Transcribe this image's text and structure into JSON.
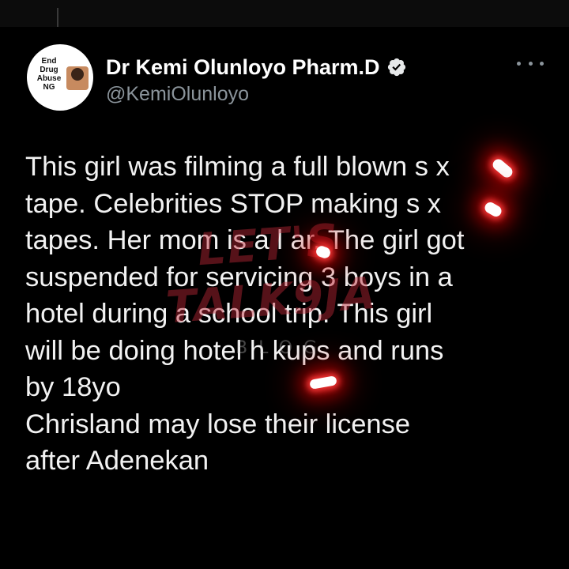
{
  "tweet": {
    "avatar_logo_text": "End Drug Abuse NG",
    "display_name": "Dr Kemi Olunloyo Pharm.D",
    "handle": "@KemiOlunloyo",
    "body_lines": [
      "This girl was filming a full blown s  x",
      "tape. Celebrities STOP making s  x",
      "tapes. Her mom is a l  ar. The girl got",
      "suspended for servicing 3 boys in a",
      "hotel during a school trip. This girl",
      "will be doing hotel h     kups and runs",
      "by 18yo",
      "Chrisland may lose their license",
      "after Adenekan"
    ]
  },
  "watermark": {
    "line1": "LET'S",
    "line2": "TALK9JA",
    "line3": "BLOG"
  },
  "icons": {
    "verified": "verified-badge-icon",
    "more": "more-options-icon"
  },
  "colors": {
    "background": "#000000",
    "text": "#f2f2f2",
    "handle": "#8b949b",
    "watermark": "#be2837",
    "censor_glow": "#ff0000"
  }
}
